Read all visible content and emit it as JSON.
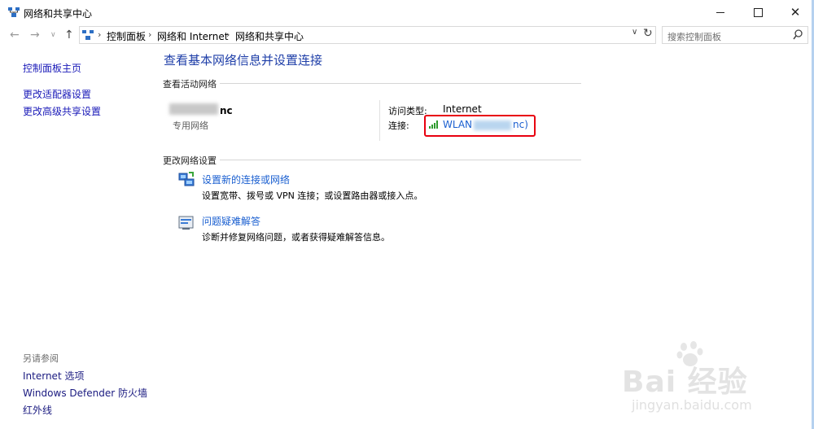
{
  "window": {
    "title": "网络和共享中心",
    "controls": {
      "minimize": "minimize",
      "maximize": "maximize",
      "close": "✕"
    }
  },
  "address": {
    "breadcrumbs": [
      "控制面板",
      "网络和 Internet",
      "网络和共享中心"
    ],
    "search_placeholder": "搜索控制面板"
  },
  "sidebar": {
    "items": [
      {
        "label": "控制面板主页"
      },
      {
        "label": "更改适配器设置"
      },
      {
        "label": "更改高级共享设置"
      }
    ],
    "see_also_title": "另请参阅",
    "see_also": [
      {
        "label": "Internet 选项"
      },
      {
        "label": "Windows Defender 防火墙"
      },
      {
        "label": "红外线"
      }
    ]
  },
  "main": {
    "title": "查看基本网络信息并设置连接",
    "active_networks_header": "查看活动网络",
    "network": {
      "name_visible": "nc",
      "type": "专用网络",
      "access_type_label": "访问类型:",
      "access_type_value": "Internet",
      "connection_label": "连接:",
      "connection_prefix": "WLAN",
      "connection_suffix": "nc)"
    },
    "change_settings_header": "更改网络设置",
    "tasks": [
      {
        "title": "设置新的连接或网络",
        "desc": "设置宽带、拨号或 VPN 连接；或设置路由器或接入点。",
        "icon": "network-setup-icon"
      },
      {
        "title": "问题疑难解答",
        "desc": "诊断并修复网络问题，或者获得疑难解答信息。",
        "icon": "troubleshoot-icon"
      }
    ]
  },
  "watermark": {
    "text": "Bai 经验",
    "url": "jingyan.baidu.com"
  },
  "colors": {
    "link": "#1a5fd0",
    "title": "#1e3ea8",
    "highlight_box": "#e8000f"
  }
}
